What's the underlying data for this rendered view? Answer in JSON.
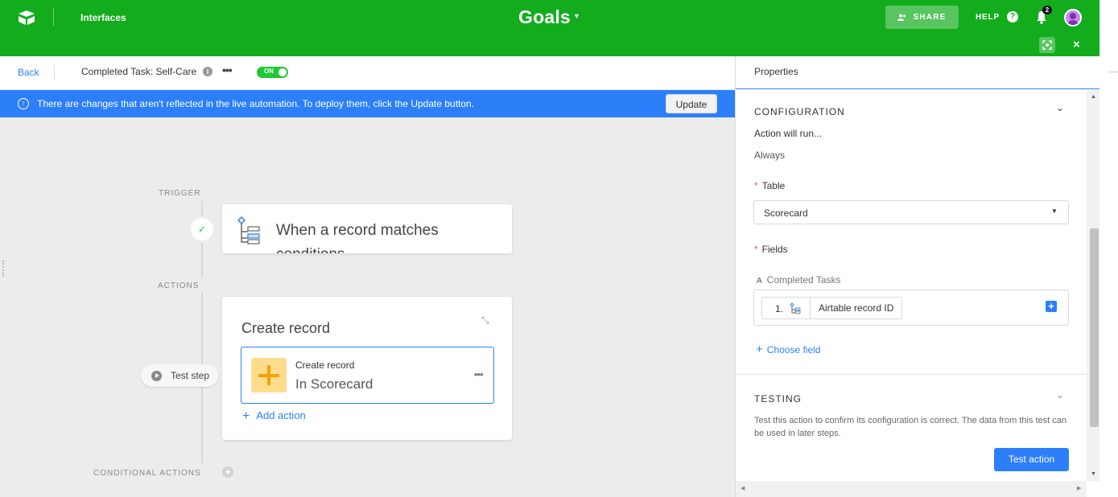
{
  "topbar": {
    "nav_label": "Interfaces",
    "base_name": "Goals",
    "share_label": "SHARE",
    "help_label": "HELP",
    "help_icon_glyph": "?",
    "notification_count": "2",
    "close_glyph": "×"
  },
  "subheader": {
    "back_label": "Back",
    "automation_name": "Completed Task: Self-Care",
    "info_glyph": "i",
    "more_glyph": "•••",
    "toggle_label": "ON"
  },
  "banner": {
    "message": "There are changes that aren't reflected in the live automation. To deploy them, click the Update button.",
    "icon_glyph": "↑",
    "update_label": "Update"
  },
  "canvas": {
    "trigger_section": "TRIGGER",
    "trigger_check": "✓",
    "trigger_title": "When a record matches conditions",
    "actions_section": "ACTIONS",
    "action_title": "Create record",
    "collapse_glyph": "⤡",
    "inner_label": "Create record",
    "inner_value": "In Scorecard",
    "inner_more": "•••",
    "add_action_label": "Add action",
    "test_step_label": "Test step",
    "conditional_section": "CONDITIONAL ACTIONS",
    "plus_glyph": "+"
  },
  "panel": {
    "title": "Properties",
    "configuration": {
      "title": "CONFIGURATION",
      "chevron": "⌄",
      "run_label": "Action will run...",
      "run_value": "Always",
      "table_label": "Table",
      "table_value": "Scorecard",
      "caret": "▼",
      "fields_label": "Fields",
      "field_type_glyph": "A",
      "field_name": "Completed Tasks",
      "token_number": "1.",
      "token_value": "Airtable record ID",
      "field_add_glyph": "+",
      "choose_field_label": "Choose field",
      "required_mark": "*"
    },
    "testing": {
      "title": "TESTING",
      "chevron": "⌄",
      "description": "Test this action to confirm its configuration is correct. The data from this test can be used in later steps.",
      "button_label": "Test action"
    },
    "scroll": {
      "up": "▲",
      "down": "▼",
      "left": "◀",
      "right": "▶"
    }
  },
  "icons": {
    "logo": "airtable-logo",
    "share": "share-users-icon",
    "bell": "bell-icon",
    "focus": "focus-icon",
    "trigger": "record-conditions-icon",
    "action": "create-record-plus-icon"
  },
  "colors": {
    "topbar": "#12ac1d",
    "accent": "#2d7ff9",
    "toggle_on": "#20c933",
    "action_icon_bg": "#ffdc8c",
    "action_icon_fg": "#f4a00c",
    "avatar": "#c68be8"
  }
}
